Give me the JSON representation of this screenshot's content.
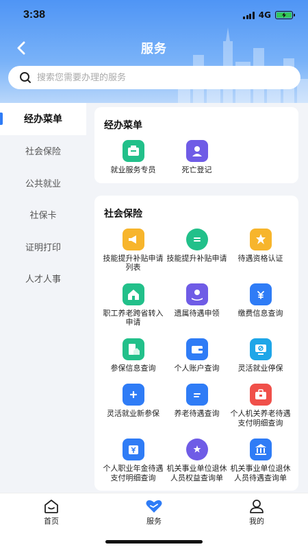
{
  "status_bar": {
    "time": "3:38",
    "network": "4G",
    "battery_fill": 1.0
  },
  "header": {
    "title": "服务",
    "back_icon": "chevron-left-icon"
  },
  "search": {
    "placeholder": "搜索您需要办理的服务",
    "icon": "search-icon"
  },
  "sidebar": {
    "items": [
      {
        "label": "经办菜单",
        "active": true
      },
      {
        "label": "社会保险",
        "active": false
      },
      {
        "label": "公共就业",
        "active": false
      },
      {
        "label": "社保卡",
        "active": false
      },
      {
        "label": "证明打印",
        "active": false
      },
      {
        "label": "人才人事",
        "active": false
      }
    ]
  },
  "sections": [
    {
      "title": "经办菜单",
      "items": [
        {
          "label": "就业服务专员",
          "icon": "employment-officer-icon",
          "color": "#22c08a"
        },
        {
          "label": "死亡登记",
          "icon": "death-registration-icon",
          "color": "#6f5ce6"
        }
      ]
    },
    {
      "title": "社会保险",
      "items": [
        {
          "label": "技能提升补贴申请列表",
          "icon": "megaphone-icon",
          "color": "#f7b52c"
        },
        {
          "label": "技能提升补贴申请",
          "icon": "chat-icon",
          "color": "#22c08a"
        },
        {
          "label": "待遇资格认证",
          "icon": "certificate-icon",
          "color": "#f7b52c"
        },
        {
          "label": "职工养老跨省转入申请",
          "icon": "house-transfer-icon",
          "color": "#22c08a"
        },
        {
          "label": "遗属待遇申领",
          "icon": "hand-care-icon",
          "color": "#6f5ce6"
        },
        {
          "label": "缴费信息查询",
          "icon": "yuan-house-icon",
          "color": "#2f7cf6"
        },
        {
          "label": "参保信息查询",
          "icon": "building-doc-icon",
          "color": "#22c08a"
        },
        {
          "label": "个人账户查询",
          "icon": "wallet-icon",
          "color": "#2f7cf6"
        },
        {
          "label": "灵活就业停保",
          "icon": "monitor-stop-icon",
          "color": "#1fa6e8"
        },
        {
          "label": "灵活就业新参保",
          "icon": "house-plus-icon",
          "color": "#2f7cf6"
        },
        {
          "label": "养老待遇查询",
          "icon": "document-icon",
          "color": "#2f7cf6"
        },
        {
          "label": "个人机关养老待遇支付明细查询",
          "icon": "briefcase-icon",
          "color": "#f0504a"
        },
        {
          "label": "个人职业年金待遇支付明细查询",
          "icon": "yuan-box-icon",
          "color": "#2f7cf6"
        },
        {
          "label": "机关事业单位退休人员权益查询单",
          "icon": "shield-star-icon",
          "color": "#6f5ce6"
        },
        {
          "label": "机关事业单位退休人员待遇查询单",
          "icon": "bank-icon",
          "color": "#2f7cf6"
        }
      ]
    }
  ],
  "tab_bar": {
    "tabs": [
      {
        "label": "首页",
        "icon": "home-icon",
        "active": false
      },
      {
        "label": "服务",
        "icon": "heart-service-icon",
        "active": true
      },
      {
        "label": "我的",
        "icon": "user-icon",
        "active": false
      }
    ],
    "active_color": "#2f7cf6"
  }
}
